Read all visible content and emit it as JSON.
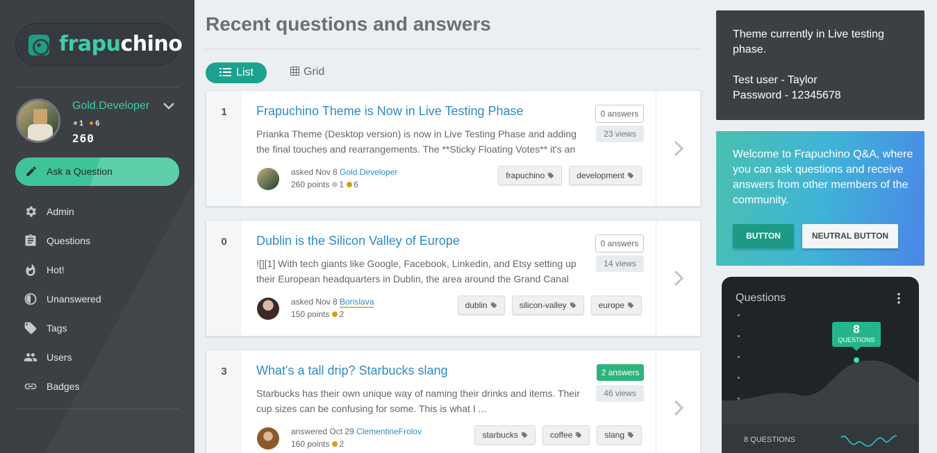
{
  "brand": {
    "name_part1": "frapu",
    "name_part2": "chino",
    "accent": "#3fcca9"
  },
  "user": {
    "name": "Gold.Developer",
    "silver_count": "1",
    "gold_count": "6",
    "points": "260"
  },
  "sidebar": {
    "ask_label": "Ask a Question",
    "items": [
      {
        "label": "Admin",
        "icon": "gear-icon"
      },
      {
        "label": "Questions",
        "icon": "clipboard-icon"
      },
      {
        "label": "Hot!",
        "icon": "flame-icon"
      },
      {
        "label": "Unanswered",
        "icon": "half-circle-icon"
      },
      {
        "label": "Tags",
        "icon": "tag-icon"
      },
      {
        "label": "Users",
        "icon": "users-icon"
      },
      {
        "label": "Badges",
        "icon": "link-icon"
      }
    ]
  },
  "main": {
    "title": "Recent questions and answers",
    "view_list": "List",
    "view_grid": "Grid",
    "questions": [
      {
        "score": "1",
        "title": "Frapuchino Theme is Now in Live Testing Phase",
        "excerpt": "Prianka Theme (Desktop version) is now in Live Testing Phase and adding the final touches and rearrangements. The **Sticky Floating Votes** it's an",
        "answers": "0 answers",
        "views": "23 views",
        "action": "asked Nov 8",
        "author": "Gold.Developer",
        "points": "260 points",
        "silver": "1",
        "gold": "6",
        "tags": [
          "frapuchino",
          "development"
        ]
      },
      {
        "score": "0",
        "title": "Dublin is the Silicon Valley of Europe",
        "excerpt": "![][1] With tech giants like Google, Facebook, Linkedin, and Etsy setting up their European headquarters in Dublin, the area around the Grand Canal",
        "answers": "0 answers",
        "views": "14 views",
        "action": "asked Nov 8",
        "author": "Borislava",
        "points": "150 points",
        "gold": "2",
        "tags": [
          "dublin",
          "silicon-valley",
          "europe"
        ]
      },
      {
        "score": "3",
        "title": "What's a tall drip? Starbucks slang",
        "excerpt": "Starbucks has their own unique way of naming their drinks and items. Their cup sizes can be confusing for some. This is what I ...",
        "answers": "2 answers",
        "views": "46 views",
        "action": "answered Oct 29",
        "author": "ClementineFrolov",
        "points": "160 points",
        "gold": "2",
        "tags": [
          "starbucks",
          "coffee",
          "slang"
        ]
      }
    ]
  },
  "notice": {
    "line1": "Theme currently in Live testing phase.",
    "line2": "Test user - Taylor",
    "line3": "Password - 12345678"
  },
  "welcome": {
    "text": "Welcome to Frapuchino Q&A, where you can ask questions and receive answers from other members of the community.",
    "button_primary": "BUTTON",
    "button_neutral": "NEUTRAL BUTTON"
  },
  "stats": {
    "title": "Questions",
    "bubble_number": "8",
    "bubble_label": "QUESTIONS",
    "footer_label": "8 QUESTIONS"
  }
}
